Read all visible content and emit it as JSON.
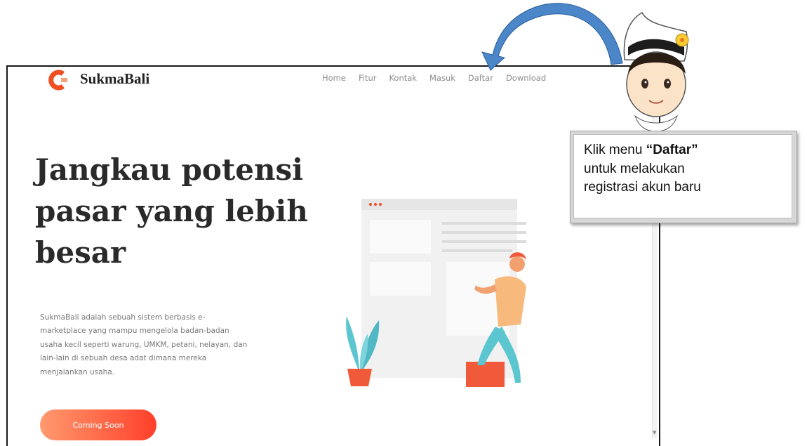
{
  "brand": {
    "name": "SukmaBali",
    "color": "#f04e23"
  },
  "nav": {
    "items": [
      "Home",
      "Fitur",
      "Kontak",
      "Masuk",
      "Daftar",
      "Download"
    ]
  },
  "hero": {
    "line1": "Jangkau potensi",
    "line2": "pasar yang lebih",
    "line3": "besar"
  },
  "description": "SukmaBali adalah sebuah sistem berbasis e-marketplace yang mampu mengelola badan-badan usaha kecil seperti warung, UMKM, petani, nelayan, dan lain-lain di sebuah desa adat dimana mereka menjalankan usaha.",
  "cta": {
    "label": "Coming Soon"
  },
  "callout": {
    "prefix": "Klik menu ",
    "highlight": "“Daftar”",
    "line2": "untuk melakukan",
    "line3": "registrasi akun baru"
  },
  "colors": {
    "accent": "#ff3f2a",
    "arrow": "#4a86c8",
    "teal": "#5cc6d0"
  },
  "icons": [
    "logo-icon",
    "curved-arrow-icon",
    "character-illustration",
    "hero-illustration"
  ]
}
